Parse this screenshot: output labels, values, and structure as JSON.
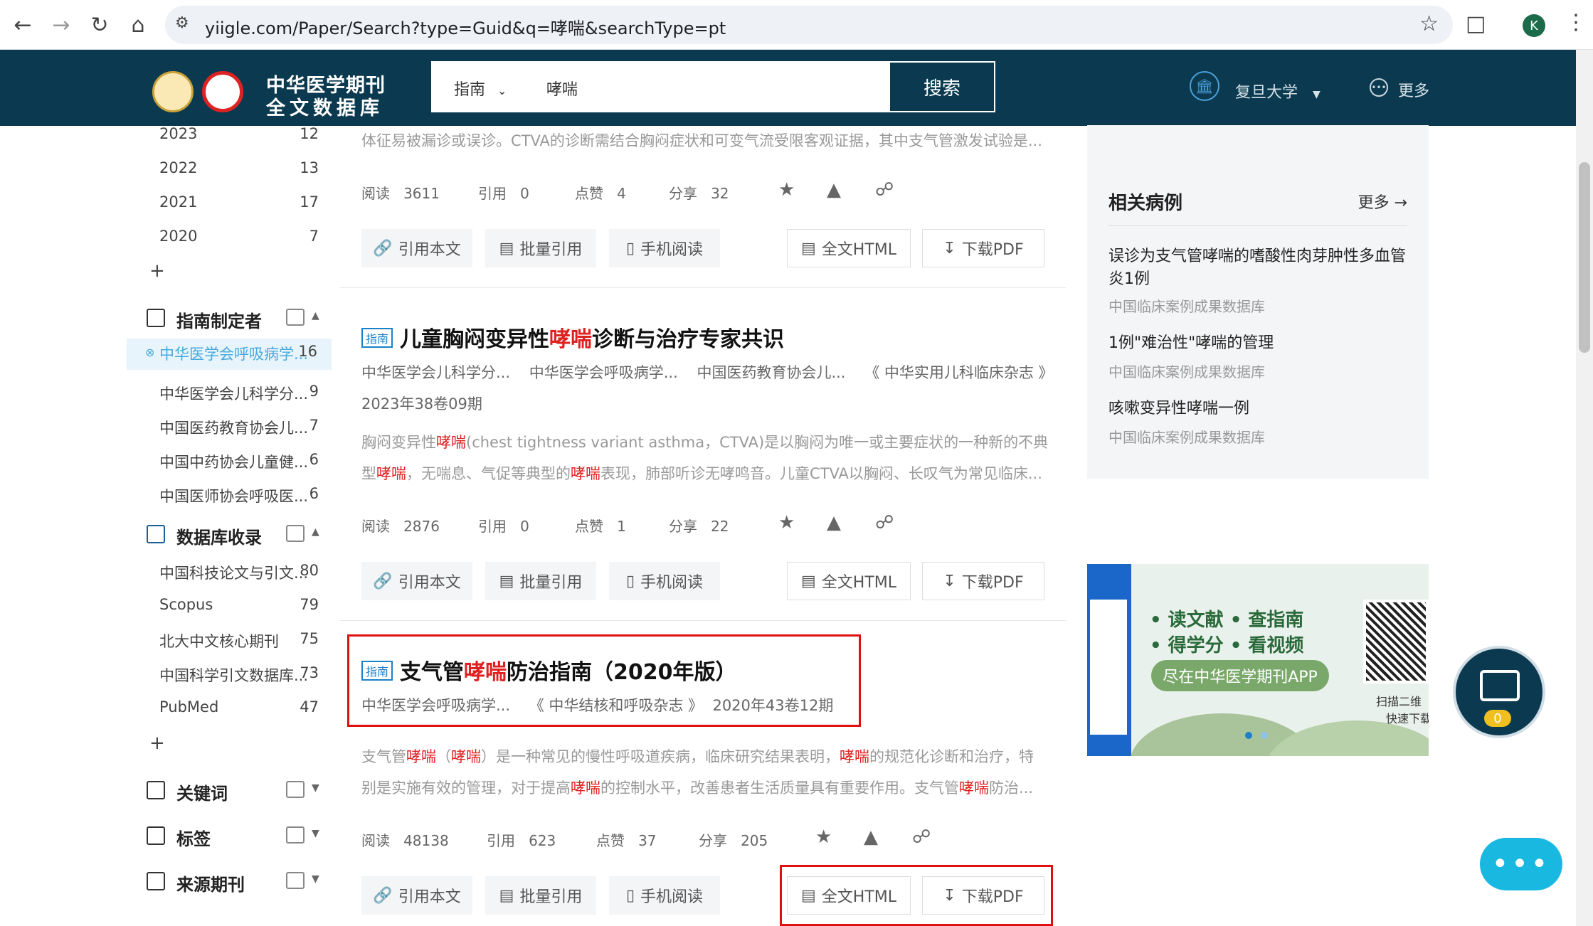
{
  "browser": {
    "url": "yiigle.com/Paper/Search?type=Guid&q=哮喘&searchType=pt",
    "profile_initial": "K"
  },
  "header": {
    "brand_line1": "中华医学期刊",
    "brand_line2": "全文数据库",
    "search_type": "指南",
    "search_query": "哮喘",
    "search_button": "搜索",
    "institution": "复旦大学",
    "more": "更多"
  },
  "sidebar": {
    "years": [
      {
        "label": "2023",
        "count": "12"
      },
      {
        "label": "2022",
        "count": "13"
      },
      {
        "label": "2021",
        "count": "17"
      },
      {
        "label": "2020",
        "count": "7"
      }
    ],
    "plus1": "+",
    "groups": [
      {
        "title": "指南制定者",
        "items": [
          {
            "label": "中华医学会呼吸病学...",
            "count": "16"
          },
          {
            "label": "中华医学会儿科学分...",
            "count": "9"
          },
          {
            "label": "中国医药教育协会儿...",
            "count": "7"
          },
          {
            "label": "中国中药协会儿童健...",
            "count": "6"
          },
          {
            "label": "中国医师协会呼吸医...",
            "count": "6"
          }
        ]
      },
      {
        "title": "数据库收录",
        "items": [
          {
            "label": "中国科技论文与引文...",
            "count": "80"
          },
          {
            "label": "Scopus",
            "count": "79"
          },
          {
            "label": "北大中文核心期刊",
            "count": "75"
          },
          {
            "label": "中国科学引文数据库...",
            "count": "73"
          },
          {
            "label": "PubMed",
            "count": "47"
          }
        ]
      }
    ],
    "plus2": "+",
    "collapsed": [
      "关键词",
      "标签",
      "来源期刊"
    ]
  },
  "articles": [
    {
      "desc_line": "体征易被漏诊或误诊。CTVA的诊断需结合胸闷症状和可变气流受限客观证据，其中支气管激发试验是...",
      "stats": {
        "read_label": "阅读",
        "read": "3611",
        "cite_label": "引用",
        "cite": "0",
        "like_label": "点赞",
        "like": "4",
        "share_label": "分享",
        "share": "32"
      }
    },
    {
      "tag": "指南",
      "title_pre": "儿童胸闷变异性",
      "title_hl": "哮喘",
      "title_post": "诊断与治疗专家共识",
      "authors": "中华医学会儿科学分...    中华医学会呼吸病学...    中国医药教育协会儿...",
      "journal": "《 中华实用儿科临床杂志 》",
      "issue": "2023年38卷09期",
      "desc1_a": "胸闷变异性",
      "desc1_hl": "哮喘",
      "desc1_b": "(chest tightness variant asthma，CTVA)是以胸闷为唯一或主要症状的一种新的不典",
      "desc2_a": "型",
      "desc2_hl1": "哮喘",
      "desc2_b": "，无喘息、气促等典型的",
      "desc2_hl2": "哮喘",
      "desc2_c": "表现，肺部听诊无哮鸣音。儿童CTVA以胸闷、长叹气为常见临床...",
      "stats": {
        "read_label": "阅读",
        "read": "2876",
        "cite_label": "引用",
        "cite": "0",
        "like_label": "点赞",
        "like": "1",
        "share_label": "分享",
        "share": "22"
      }
    },
    {
      "tag": "指南",
      "title_pre": "支气管",
      "title_hl": "哮喘",
      "title_post": "防治指南（2020年版）",
      "authors": "中华医学会呼吸病学...",
      "journal": "《 中华结核和呼吸杂志 》",
      "issue": "2020年43卷12期",
      "desc1_a": "支气管",
      "desc1_hl1": "哮喘",
      "desc1_b": "（",
      "desc1_hl2": "哮喘",
      "desc1_c": "）是一种常见的慢性呼吸道疾病，临床研究结果表明，",
      "desc1_hl3": "哮喘",
      "desc1_d": "的规范化诊断和治疗，特",
      "desc2_a": "别是实施有效的管理，对于提高",
      "desc2_hl1": "哮喘",
      "desc2_b": "的控制水平，改善患者生活质量具有重要作用。支气管",
      "desc2_hl2": "哮喘",
      "desc2_c": "防治...",
      "stats": {
        "read_label": "阅读",
        "read": "48138",
        "cite_label": "引用",
        "cite": "623",
        "like_label": "点赞",
        "like": "37",
        "share_label": "分享",
        "share": "205"
      }
    }
  ],
  "actions": {
    "cite": "引用本文",
    "batch": "批量引用",
    "mobile": "手机阅读",
    "html": "全文HTML",
    "pdf": "下载PDF"
  },
  "related": {
    "title": "相关病例",
    "more": "更多 →",
    "items": [
      {
        "title": "误诊为支气管哮喘的嗜酸性肉芽肿性多血管炎1例",
        "source": "中国临床案例成果数据库"
      },
      {
        "title": "1例\"难治性\"哮喘的管理",
        "source": "中国临床案例成果数据库"
      },
      {
        "title": "咳嗽变异性哮喘一例",
        "source": "中国临床案例成果数据库"
      }
    ]
  },
  "banner": {
    "line1": "• 读文献  • 查指南",
    "line2": "• 得学分  • 看视频",
    "pill": "尽在中华医学期刊APP",
    "qr1": "扫描二维",
    "qr2": "快速下载"
  },
  "float_badge": "0",
  "chat": "•••"
}
